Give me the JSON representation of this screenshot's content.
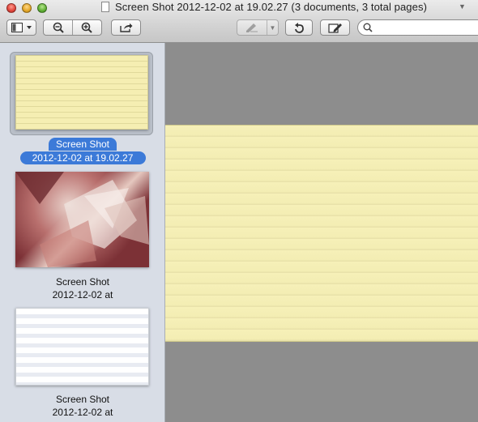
{
  "window": {
    "title": "Screen Shot 2012-12-02 at 19.02.27 (3 documents, 3 total pages)",
    "title_menu_icon": "chevron-down-icon"
  },
  "toolbar": {
    "buttons": [
      "sidebar-toggle-icon",
      "zoom-out-icon",
      "zoom-in-icon",
      "share-icon",
      "markup-icon",
      "rotate-icon",
      "annotate-icon"
    ],
    "search": {
      "value": "",
      "placeholder": ""
    }
  },
  "sidebar": {
    "items": [
      {
        "line1": "Screen Shot",
        "line2": "2012-12-02 at 19.02.27",
        "selected": true
      },
      {
        "line1": "Screen Shot",
        "line2": "2012-12-02 at",
        "selected": false
      },
      {
        "line1": "Screen Shot",
        "line2": "2012-12-02 at",
        "selected": false
      }
    ]
  },
  "colors": {
    "selection": "#3c7ad8",
    "paper": "#f6f0b8",
    "viewer_bg": "#8d8d8d",
    "sidebar_bg": "#d8dde6"
  }
}
